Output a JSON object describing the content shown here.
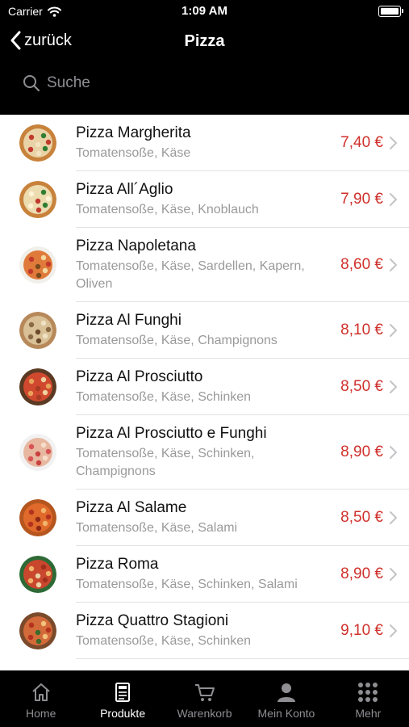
{
  "status_bar": {
    "carrier": "Carrier",
    "time": "1:09 AM"
  },
  "nav": {
    "back_label": "zurück",
    "title": "Pizza"
  },
  "search": {
    "placeholder": "Suche"
  },
  "items": [
    {
      "name": "Pizza Margherita",
      "description": "Tomatensoße, Käse",
      "price": "7,40 €"
    },
    {
      "name": "Pizza All´Aglio",
      "description": "Tomatensoße, Käse, Knoblauch",
      "price": "7,90 €"
    },
    {
      "name": "Pizza Napoletana",
      "description": "Tomatensoße, Käse, Sardellen, Kapern, Oliven",
      "price": "8,60 €"
    },
    {
      "name": "Pizza Al Funghi",
      "description": "Tomatensoße, Käse, Champignons",
      "price": "8,10 €"
    },
    {
      "name": "Pizza Al Prosciutto",
      "description": "Tomatensoße, Käse, Schinken",
      "price": "8,50 €"
    },
    {
      "name": "Pizza Al Prosciutto e Funghi",
      "description": "Tomatensoße, Käse, Schinken, Champignons",
      "price": "8,90 €"
    },
    {
      "name": "Pizza Al Salame",
      "description": "Tomatensoße, Käse, Salami",
      "price": "8,50 €"
    },
    {
      "name": "Pizza Roma",
      "description": "Tomatensoße, Käse, Schinken, Salami",
      "price": "8,90 €"
    },
    {
      "name": "Pizza Quattro Stagioni",
      "description": "Tomatensoße, Käse, Schinken",
      "price": "9,10 €"
    }
  ],
  "tabs": [
    {
      "label": "Home",
      "icon": "home-icon",
      "active": false
    },
    {
      "label": "Produkte",
      "icon": "menu-card-icon",
      "active": true
    },
    {
      "label": "Warenkorb",
      "icon": "cart-icon",
      "active": false
    },
    {
      "label": "Mein Konto",
      "icon": "person-icon",
      "active": false
    },
    {
      "label": "Mehr",
      "icon": "more-grid-icon",
      "active": false
    }
  ],
  "colors": {
    "price": "#d0302b",
    "bar_background": "#000000",
    "tab_active": "#ffffff",
    "tab_inactive": "#8e8e93"
  }
}
